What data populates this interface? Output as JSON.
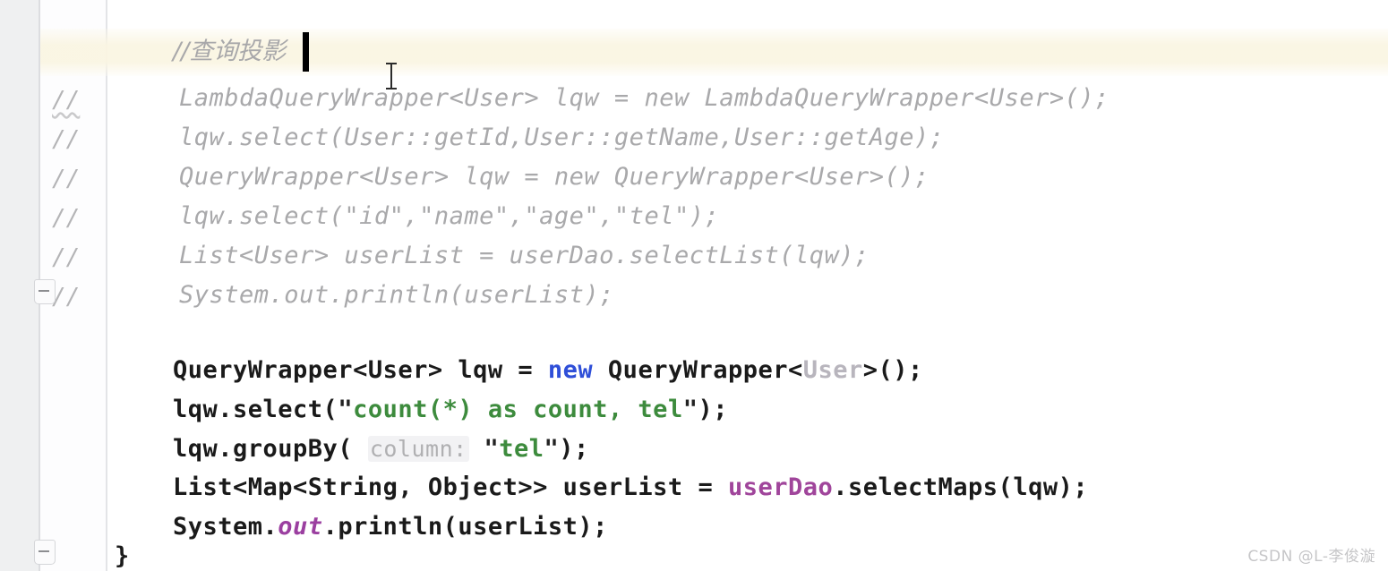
{
  "editor": {
    "app": "IntelliJ IDEA",
    "language": "Java",
    "theme": "light",
    "colors": {
      "background": "#ffffff",
      "gutter_background": "#fdfdfe",
      "left_strip": "#eff0f1",
      "current_line_highlight": "#faf5e2",
      "comment": "#a9a9ab",
      "keyword": "#2f4fd8",
      "string": "#3d8b3d",
      "field": "#a0459b",
      "static_field": "#9b3fa0",
      "param_hint": "#b0b0b2",
      "faded_type": "#b8b5bd",
      "text": "#1a1a1a",
      "caret": "#000000",
      "watermark": "#c6c6c8"
    },
    "caret": {
      "visible": true,
      "line": 1,
      "after_text": "//查询投影"
    },
    "closing_brace": "}"
  },
  "gutter": {
    "marks": [
      {
        "text": "//",
        "squiggly": true
      },
      {
        "text": "//",
        "squiggly": false
      },
      {
        "text": "//",
        "squiggly": false
      },
      {
        "text": "//",
        "squiggly": false
      },
      {
        "text": "//",
        "squiggly": false
      },
      {
        "text": "//",
        "squiggly": false
      }
    ],
    "fold_markers": 2
  },
  "code": {
    "comment_header": "//查询投影",
    "commented_lines": [
      "    LambdaQueryWrapper<User> lqw = new LambdaQueryWrapper<User>();",
      "    lqw.select(User::getId,User::getName,User::getAge);",
      "    QueryWrapper<User> lqw = new QueryWrapper<User>();",
      "    lqw.select(\"id\",\"name\",\"age\",\"tel\");",
      "    List<User> userList = userDao.selectList(lqw);",
      "    System.out.println(userList);"
    ],
    "active_lines": [
      {
        "id": "line-querywrapper-decl",
        "tokens": [
          {
            "t": "QueryWrapper<User> lqw = ",
            "c": "plain"
          },
          {
            "t": "new",
            "c": "keyword"
          },
          {
            "t": " QueryWrapper<",
            "c": "plain"
          },
          {
            "t": "User",
            "c": "faded"
          },
          {
            "t": ">();",
            "c": "plain"
          }
        ]
      },
      {
        "id": "line-select",
        "tokens": [
          {
            "t": "lqw.select(",
            "c": "plain"
          },
          {
            "t": "\"",
            "c": "quote"
          },
          {
            "t": "count(*) as count, tel",
            "c": "string"
          },
          {
            "t": "\"",
            "c": "quote"
          },
          {
            "t": ");",
            "c": "plain"
          }
        ]
      },
      {
        "id": "line-groupby",
        "tokens": [
          {
            "t": "lqw.groupBy( ",
            "c": "plain"
          },
          {
            "t": "column:",
            "c": "hint"
          },
          {
            "t": " ",
            "c": "plain"
          },
          {
            "t": "\"",
            "c": "quote"
          },
          {
            "t": "tel",
            "c": "string"
          },
          {
            "t": "\"",
            "c": "quote"
          },
          {
            "t": ");",
            "c": "plain"
          }
        ]
      },
      {
        "id": "line-selectmaps",
        "tokens": [
          {
            "t": "List<Map<String, Object>> userList = ",
            "c": "plain"
          },
          {
            "t": "userDao",
            "c": "field"
          },
          {
            "t": ".selectMaps(lqw);",
            "c": "plain"
          }
        ]
      },
      {
        "id": "line-println",
        "tokens": [
          {
            "t": "System.",
            "c": "plain"
          },
          {
            "t": "out",
            "c": "static"
          },
          {
            "t": ".println(userList);",
            "c": "plain"
          }
        ]
      }
    ]
  },
  "watermark": {
    "text": "CSDN @L-李俊漩"
  }
}
